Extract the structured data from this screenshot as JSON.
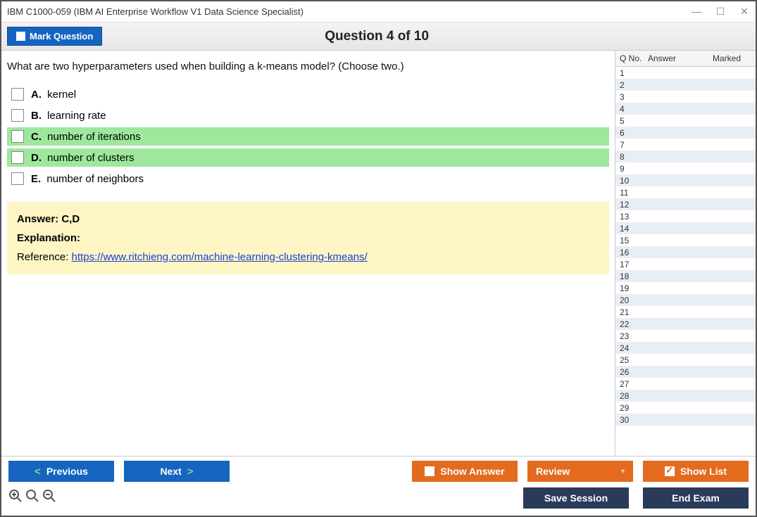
{
  "window": {
    "title": "IBM C1000-059 (IBM AI Enterprise Workflow V1 Data Science Specialist)"
  },
  "toolbar": {
    "mark_label": "Mark Question",
    "question_title": "Question 4 of 10"
  },
  "question": {
    "text": "What are two hyperparameters used when building a k-means model? (Choose two.)",
    "options": [
      {
        "letter": "A.",
        "text": "kernel",
        "correct": false
      },
      {
        "letter": "B.",
        "text": "learning rate",
        "correct": false
      },
      {
        "letter": "C.",
        "text": "number of iterations",
        "correct": true
      },
      {
        "letter": "D.",
        "text": "number of clusters",
        "correct": true
      },
      {
        "letter": "E.",
        "text": "number of neighbors",
        "correct": false
      }
    ],
    "answer_label": "Answer: C,D",
    "explanation_label": "Explanation:",
    "reference_prefix": "Reference: ",
    "reference_url": "https://www.ritchieng.com/machine-learning-clustering-kmeans/"
  },
  "sidebar": {
    "header": {
      "qno": "Q No.",
      "answer": "Answer",
      "marked": "Marked"
    },
    "rows": [
      1,
      2,
      3,
      4,
      5,
      6,
      7,
      8,
      9,
      10,
      11,
      12,
      13,
      14,
      15,
      16,
      17,
      18,
      19,
      20,
      21,
      22,
      23,
      24,
      25,
      26,
      27,
      28,
      29,
      30
    ]
  },
  "footer": {
    "previous": "Previous",
    "next": "Next",
    "show_answer": "Show Answer",
    "review": "Review",
    "show_list": "Show List",
    "save_session": "Save Session",
    "end_exam": "End Exam"
  }
}
